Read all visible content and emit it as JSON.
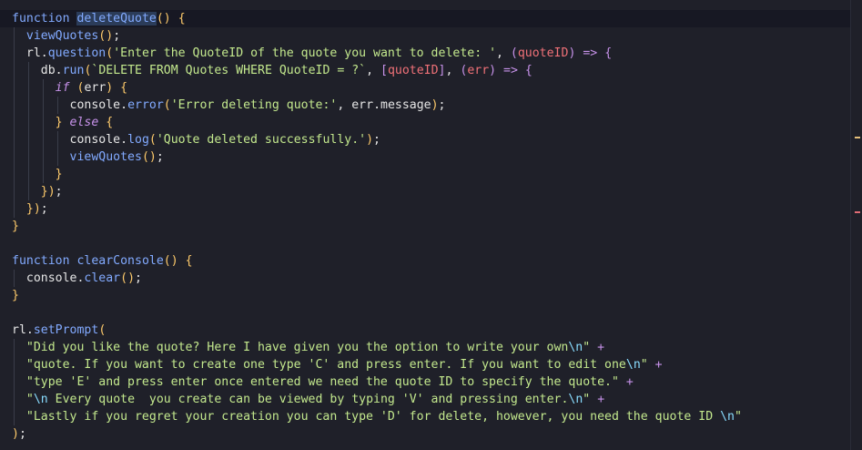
{
  "editor": {
    "language": "javascript",
    "colors": {
      "background": "#1f2029",
      "keyword": "#82aaff",
      "string": "#c3e88d",
      "parameter": "#f07178",
      "bracket": "#ffcb6b",
      "operator": "#c792ea"
    },
    "lines": [
      "function deleteQuote() {",
      "  viewQuotes();",
      "  rl.question('Enter the QuoteID of the quote you want to delete: ', (quoteID) => {",
      "    db.run(`DELETE FROM Quotes WHERE QuoteID = ?`, [quoteID], (err) => {",
      "      if (err) {",
      "        console.error('Error deleting quote:', err.message);",
      "      } else {",
      "        console.log('Quote deleted successfully.');",
      "        viewQuotes();",
      "      }",
      "    });",
      "  });",
      "}",
      "",
      "function clearConsole() {",
      "  console.clear();",
      "}",
      "",
      "rl.setPrompt(",
      "  \"Did you like the quote? Here I have given you the option to write your own\\n\" +",
      "  \"quote. If you want to create one type 'C' and press enter. If you want to edit one\\n\" +",
      "  \"type 'E' and press enter once entered we need the quote ID to specify the quote.\" +",
      "  \"\\n Every quote  you create can be viewed by typing 'V' and pressing enter.\\n\" +",
      "  \"Lastly if you regret your creation you can type 'D' for delete, however, you need the quote ID \\n\"",
      ");"
    ]
  }
}
